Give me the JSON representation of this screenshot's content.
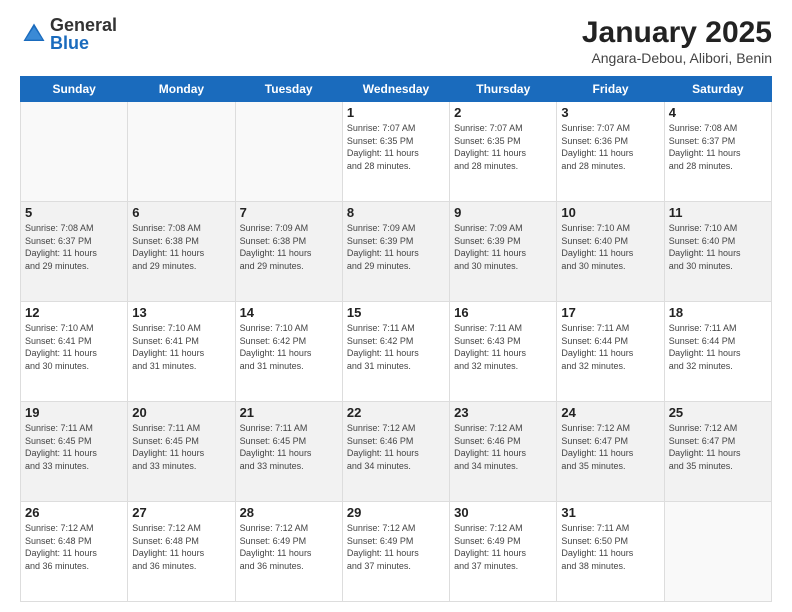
{
  "header": {
    "logo_general": "General",
    "logo_blue": "Blue",
    "title": "January 2025",
    "subtitle": "Angara-Debou, Alibori, Benin"
  },
  "weekdays": [
    "Sunday",
    "Monday",
    "Tuesday",
    "Wednesday",
    "Thursday",
    "Friday",
    "Saturday"
  ],
  "weeks": [
    [
      {
        "day": "",
        "info": ""
      },
      {
        "day": "",
        "info": ""
      },
      {
        "day": "",
        "info": ""
      },
      {
        "day": "1",
        "info": "Sunrise: 7:07 AM\nSunset: 6:35 PM\nDaylight: 11 hours\nand 28 minutes."
      },
      {
        "day": "2",
        "info": "Sunrise: 7:07 AM\nSunset: 6:35 PM\nDaylight: 11 hours\nand 28 minutes."
      },
      {
        "day": "3",
        "info": "Sunrise: 7:07 AM\nSunset: 6:36 PM\nDaylight: 11 hours\nand 28 minutes."
      },
      {
        "day": "4",
        "info": "Sunrise: 7:08 AM\nSunset: 6:37 PM\nDaylight: 11 hours\nand 28 minutes."
      }
    ],
    [
      {
        "day": "5",
        "info": "Sunrise: 7:08 AM\nSunset: 6:37 PM\nDaylight: 11 hours\nand 29 minutes."
      },
      {
        "day": "6",
        "info": "Sunrise: 7:08 AM\nSunset: 6:38 PM\nDaylight: 11 hours\nand 29 minutes."
      },
      {
        "day": "7",
        "info": "Sunrise: 7:09 AM\nSunset: 6:38 PM\nDaylight: 11 hours\nand 29 minutes."
      },
      {
        "day": "8",
        "info": "Sunrise: 7:09 AM\nSunset: 6:39 PM\nDaylight: 11 hours\nand 29 minutes."
      },
      {
        "day": "9",
        "info": "Sunrise: 7:09 AM\nSunset: 6:39 PM\nDaylight: 11 hours\nand 30 minutes."
      },
      {
        "day": "10",
        "info": "Sunrise: 7:10 AM\nSunset: 6:40 PM\nDaylight: 11 hours\nand 30 minutes."
      },
      {
        "day": "11",
        "info": "Sunrise: 7:10 AM\nSunset: 6:40 PM\nDaylight: 11 hours\nand 30 minutes."
      }
    ],
    [
      {
        "day": "12",
        "info": "Sunrise: 7:10 AM\nSunset: 6:41 PM\nDaylight: 11 hours\nand 30 minutes."
      },
      {
        "day": "13",
        "info": "Sunrise: 7:10 AM\nSunset: 6:41 PM\nDaylight: 11 hours\nand 31 minutes."
      },
      {
        "day": "14",
        "info": "Sunrise: 7:10 AM\nSunset: 6:42 PM\nDaylight: 11 hours\nand 31 minutes."
      },
      {
        "day": "15",
        "info": "Sunrise: 7:11 AM\nSunset: 6:42 PM\nDaylight: 11 hours\nand 31 minutes."
      },
      {
        "day": "16",
        "info": "Sunrise: 7:11 AM\nSunset: 6:43 PM\nDaylight: 11 hours\nand 32 minutes."
      },
      {
        "day": "17",
        "info": "Sunrise: 7:11 AM\nSunset: 6:44 PM\nDaylight: 11 hours\nand 32 minutes."
      },
      {
        "day": "18",
        "info": "Sunrise: 7:11 AM\nSunset: 6:44 PM\nDaylight: 11 hours\nand 32 minutes."
      }
    ],
    [
      {
        "day": "19",
        "info": "Sunrise: 7:11 AM\nSunset: 6:45 PM\nDaylight: 11 hours\nand 33 minutes."
      },
      {
        "day": "20",
        "info": "Sunrise: 7:11 AM\nSunset: 6:45 PM\nDaylight: 11 hours\nand 33 minutes."
      },
      {
        "day": "21",
        "info": "Sunrise: 7:11 AM\nSunset: 6:45 PM\nDaylight: 11 hours\nand 33 minutes."
      },
      {
        "day": "22",
        "info": "Sunrise: 7:12 AM\nSunset: 6:46 PM\nDaylight: 11 hours\nand 34 minutes."
      },
      {
        "day": "23",
        "info": "Sunrise: 7:12 AM\nSunset: 6:46 PM\nDaylight: 11 hours\nand 34 minutes."
      },
      {
        "day": "24",
        "info": "Sunrise: 7:12 AM\nSunset: 6:47 PM\nDaylight: 11 hours\nand 35 minutes."
      },
      {
        "day": "25",
        "info": "Sunrise: 7:12 AM\nSunset: 6:47 PM\nDaylight: 11 hours\nand 35 minutes."
      }
    ],
    [
      {
        "day": "26",
        "info": "Sunrise: 7:12 AM\nSunset: 6:48 PM\nDaylight: 11 hours\nand 36 minutes."
      },
      {
        "day": "27",
        "info": "Sunrise: 7:12 AM\nSunset: 6:48 PM\nDaylight: 11 hours\nand 36 minutes."
      },
      {
        "day": "28",
        "info": "Sunrise: 7:12 AM\nSunset: 6:49 PM\nDaylight: 11 hours\nand 36 minutes."
      },
      {
        "day": "29",
        "info": "Sunrise: 7:12 AM\nSunset: 6:49 PM\nDaylight: 11 hours\nand 37 minutes."
      },
      {
        "day": "30",
        "info": "Sunrise: 7:12 AM\nSunset: 6:49 PM\nDaylight: 11 hours\nand 37 minutes."
      },
      {
        "day": "31",
        "info": "Sunrise: 7:11 AM\nSunset: 6:50 PM\nDaylight: 11 hours\nand 38 minutes."
      },
      {
        "day": "",
        "info": ""
      }
    ]
  ]
}
